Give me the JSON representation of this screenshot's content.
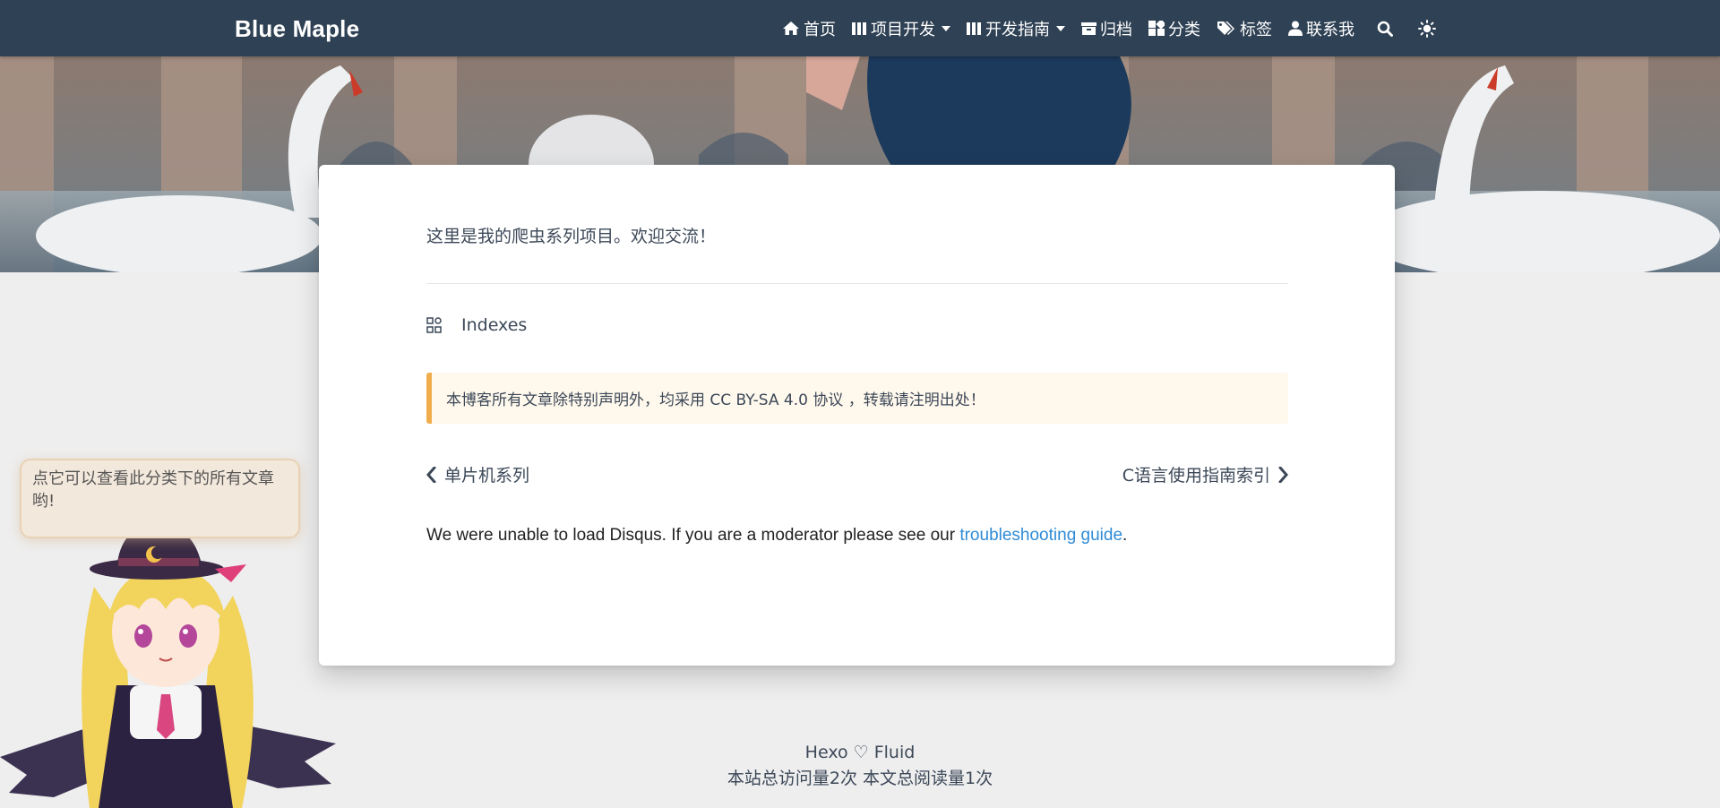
{
  "navbar": {
    "brand": "Blue Maple",
    "items": [
      {
        "label": "首页",
        "icon": "home-icon"
      },
      {
        "label": "项目开发",
        "icon": "columns-icon",
        "dropdown": true
      },
      {
        "label": "开发指南",
        "icon": "columns-icon",
        "dropdown": true
      },
      {
        "label": "归档",
        "icon": "archive-icon"
      },
      {
        "label": "分类",
        "icon": "categories-icon"
      },
      {
        "label": "标签",
        "icon": "tags-icon"
      },
      {
        "label": "联系我",
        "icon": "user-icon"
      }
    ],
    "search_icon": "search-icon",
    "theme_icon": "sun-icon"
  },
  "post": {
    "intro": "这里是我的爬虫系列项目。欢迎交流！",
    "indexes_label": "Indexes",
    "copyright_notice": "本博客所有文章除特别声明外，均采用 CC BY-SA 4.0 协议 ，转载请注明出处！",
    "prev_label": "单片机系列",
    "next_label": "C语言使用指南索引",
    "disqus_text": "We were unable to load Disqus. If you are a moderator please see our ",
    "disqus_link": "troubleshooting guide",
    "disqus_end": "."
  },
  "footer": {
    "powered": "Hexo ♡ Fluid",
    "stats": "本站总访问量2次 本文总阅读量1次"
  },
  "mascot": {
    "bubble_text": "点它可以查看此分类下的所有文章哟!"
  },
  "colors": {
    "navbar": "#2f4154",
    "notice_border": "#f0ad4e",
    "notice_bg": "#fff8ec",
    "link": "#2e8bd6"
  }
}
